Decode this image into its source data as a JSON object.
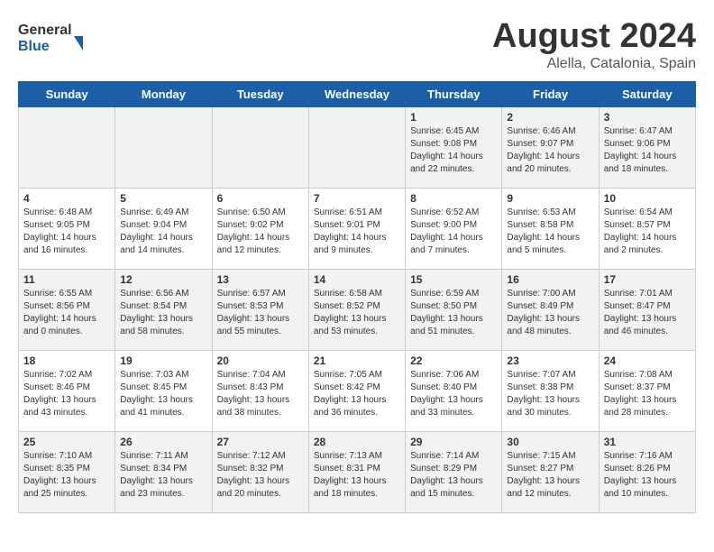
{
  "logo": {
    "text_general": "General",
    "text_blue": "Blue"
  },
  "title": {
    "month_year": "August 2024",
    "location": "Alella, Catalonia, Spain"
  },
  "days_of_week": [
    "Sunday",
    "Monday",
    "Tuesday",
    "Wednesday",
    "Thursday",
    "Friday",
    "Saturday"
  ],
  "weeks": [
    [
      {
        "day": "",
        "info": ""
      },
      {
        "day": "",
        "info": ""
      },
      {
        "day": "",
        "info": ""
      },
      {
        "day": "",
        "info": ""
      },
      {
        "day": "1",
        "info": "Sunrise: 6:45 AM\nSunset: 9:08 PM\nDaylight: 14 hours\nand 22 minutes."
      },
      {
        "day": "2",
        "info": "Sunrise: 6:46 AM\nSunset: 9:07 PM\nDaylight: 14 hours\nand 20 minutes."
      },
      {
        "day": "3",
        "info": "Sunrise: 6:47 AM\nSunset: 9:06 PM\nDaylight: 14 hours\nand 18 minutes."
      }
    ],
    [
      {
        "day": "4",
        "info": "Sunrise: 6:48 AM\nSunset: 9:05 PM\nDaylight: 14 hours\nand 16 minutes."
      },
      {
        "day": "5",
        "info": "Sunrise: 6:49 AM\nSunset: 9:04 PM\nDaylight: 14 hours\nand 14 minutes."
      },
      {
        "day": "6",
        "info": "Sunrise: 6:50 AM\nSunset: 9:02 PM\nDaylight: 14 hours\nand 12 minutes."
      },
      {
        "day": "7",
        "info": "Sunrise: 6:51 AM\nSunset: 9:01 PM\nDaylight: 14 hours\nand 9 minutes."
      },
      {
        "day": "8",
        "info": "Sunrise: 6:52 AM\nSunset: 9:00 PM\nDaylight: 14 hours\nand 7 minutes."
      },
      {
        "day": "9",
        "info": "Sunrise: 6:53 AM\nSunset: 8:58 PM\nDaylight: 14 hours\nand 5 minutes."
      },
      {
        "day": "10",
        "info": "Sunrise: 6:54 AM\nSunset: 8:57 PM\nDaylight: 14 hours\nand 2 minutes."
      }
    ],
    [
      {
        "day": "11",
        "info": "Sunrise: 6:55 AM\nSunset: 8:56 PM\nDaylight: 14 hours\nand 0 minutes."
      },
      {
        "day": "12",
        "info": "Sunrise: 6:56 AM\nSunset: 8:54 PM\nDaylight: 13 hours\nand 58 minutes."
      },
      {
        "day": "13",
        "info": "Sunrise: 6:57 AM\nSunset: 8:53 PM\nDaylight: 13 hours\nand 55 minutes."
      },
      {
        "day": "14",
        "info": "Sunrise: 6:58 AM\nSunset: 8:52 PM\nDaylight: 13 hours\nand 53 minutes."
      },
      {
        "day": "15",
        "info": "Sunrise: 6:59 AM\nSunset: 8:50 PM\nDaylight: 13 hours\nand 51 minutes."
      },
      {
        "day": "16",
        "info": "Sunrise: 7:00 AM\nSunset: 8:49 PM\nDaylight: 13 hours\nand 48 minutes."
      },
      {
        "day": "17",
        "info": "Sunrise: 7:01 AM\nSunset: 8:47 PM\nDaylight: 13 hours\nand 46 minutes."
      }
    ],
    [
      {
        "day": "18",
        "info": "Sunrise: 7:02 AM\nSunset: 8:46 PM\nDaylight: 13 hours\nand 43 minutes."
      },
      {
        "day": "19",
        "info": "Sunrise: 7:03 AM\nSunset: 8:45 PM\nDaylight: 13 hours\nand 41 minutes."
      },
      {
        "day": "20",
        "info": "Sunrise: 7:04 AM\nSunset: 8:43 PM\nDaylight: 13 hours\nand 38 minutes."
      },
      {
        "day": "21",
        "info": "Sunrise: 7:05 AM\nSunset: 8:42 PM\nDaylight: 13 hours\nand 36 minutes."
      },
      {
        "day": "22",
        "info": "Sunrise: 7:06 AM\nSunset: 8:40 PM\nDaylight: 13 hours\nand 33 minutes."
      },
      {
        "day": "23",
        "info": "Sunrise: 7:07 AM\nSunset: 8:38 PM\nDaylight: 13 hours\nand 30 minutes."
      },
      {
        "day": "24",
        "info": "Sunrise: 7:08 AM\nSunset: 8:37 PM\nDaylight: 13 hours\nand 28 minutes."
      }
    ],
    [
      {
        "day": "25",
        "info": "Sunrise: 7:10 AM\nSunset: 8:35 PM\nDaylight: 13 hours\nand 25 minutes."
      },
      {
        "day": "26",
        "info": "Sunrise: 7:11 AM\nSunset: 8:34 PM\nDaylight: 13 hours\nand 23 minutes."
      },
      {
        "day": "27",
        "info": "Sunrise: 7:12 AM\nSunset: 8:32 PM\nDaylight: 13 hours\nand 20 minutes."
      },
      {
        "day": "28",
        "info": "Sunrise: 7:13 AM\nSunset: 8:31 PM\nDaylight: 13 hours\nand 18 minutes."
      },
      {
        "day": "29",
        "info": "Sunrise: 7:14 AM\nSunset: 8:29 PM\nDaylight: 13 hours\nand 15 minutes."
      },
      {
        "day": "30",
        "info": "Sunrise: 7:15 AM\nSunset: 8:27 PM\nDaylight: 13 hours\nand 12 minutes."
      },
      {
        "day": "31",
        "info": "Sunrise: 7:16 AM\nSunset: 8:26 PM\nDaylight: 13 hours\nand 10 minutes."
      }
    ]
  ]
}
